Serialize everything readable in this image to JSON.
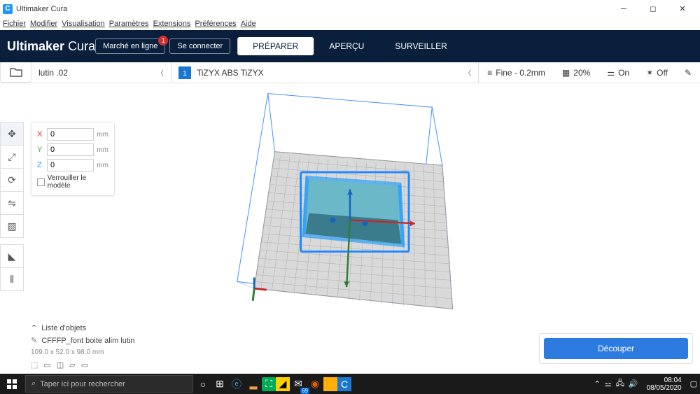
{
  "window": {
    "title": "Ultimaker Cura"
  },
  "menu": {
    "items": [
      "Fichier",
      "Modifier",
      "Visualisation",
      "Paramètres",
      "Extensions",
      "Préférences",
      "Aide"
    ]
  },
  "brand": {
    "bold": "Ultimaker",
    "light": "Cura"
  },
  "stages": {
    "prepare": "PRÉPARER",
    "preview": "APERÇU",
    "monitor": "SURVEILLER"
  },
  "topbuttons": {
    "marketplace": "Marché en ligne",
    "marketplace_badge": "1",
    "signin": "Se connecter"
  },
  "subbar": {
    "filename": "lutin .02",
    "material": "TiZYX ABS TiZYX",
    "profile": "Fine - 0.2mm",
    "infill": "20%",
    "support": "On",
    "adhesion": "Off"
  },
  "movepanel": {
    "x": "0",
    "y": "0",
    "z": "0",
    "unit": "mm",
    "lock": "Verrouiller le modèle"
  },
  "objlist": {
    "header": "Liste d'objets",
    "item": "CFFFP_font boite alim lutin",
    "dims": "109.0 x 52.0 x 98.0 mm"
  },
  "slice": {
    "label": "Découper"
  },
  "taskbar": {
    "search_placeholder": "Taper ici pour rechercher",
    "time": "08:04",
    "date": "08/05/2020",
    "mail_count": "69"
  }
}
